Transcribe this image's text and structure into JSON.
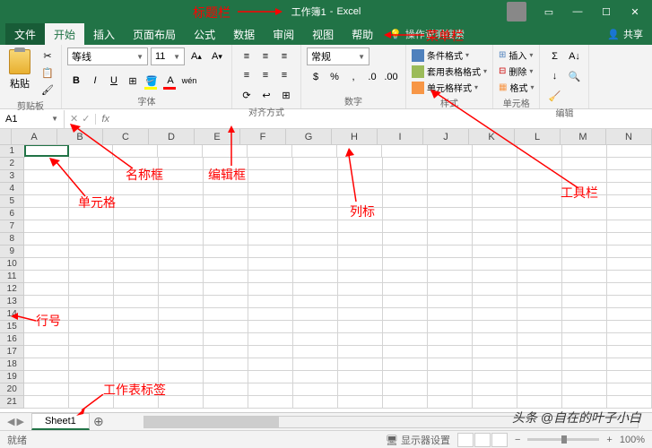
{
  "titlebar": {
    "title_doc": "工作簿1",
    "title_app": "Excel",
    "annotation": "标题栏"
  },
  "tabs": {
    "file": "文件",
    "home": "开始",
    "insert": "插入",
    "layout": "页面布局",
    "formula": "公式",
    "data": "数据",
    "review": "审阅",
    "view": "视图",
    "help": "帮助",
    "tellme": "操作说明搜索",
    "share": "共享",
    "annotation": "菜单栏"
  },
  "ribbon": {
    "clipboard": {
      "label": "剪贴板",
      "paste": "粘贴"
    },
    "font": {
      "label": "字体",
      "name": "等线",
      "size": "11"
    },
    "alignment": {
      "label": "对齐方式"
    },
    "number": {
      "label": "数字",
      "format": "常规"
    },
    "styles": {
      "label": "样式",
      "conditional": "条件格式",
      "table": "套用表格格式",
      "cell": "单元格样式"
    },
    "cells": {
      "label": "单元格",
      "insert": "插入",
      "delete": "删除",
      "format": "格式"
    },
    "editing": {
      "label": "编辑"
    },
    "annotation": "工具栏"
  },
  "formula_bar": {
    "name_box": "A1",
    "fx": "fx",
    "name_annotation": "名称框",
    "edit_annotation": "编辑框"
  },
  "grid": {
    "columns": [
      "A",
      "B",
      "C",
      "D",
      "E",
      "F",
      "G",
      "H",
      "I",
      "J",
      "K",
      "L",
      "M",
      "N"
    ],
    "rows": [
      1,
      2,
      3,
      4,
      5,
      6,
      7,
      8,
      9,
      10,
      11,
      12,
      13,
      14,
      15,
      16,
      17,
      18,
      19,
      20,
      21
    ],
    "col_annotation": "列标",
    "row_annotation": "行号",
    "cell_annotation": "单元格"
  },
  "sheets": {
    "active": "Sheet1",
    "annotation": "工作表标签"
  },
  "statusbar": {
    "ready": "就绪",
    "display": "显示器设置",
    "zoom": "100%"
  },
  "watermark": "头条 @自在的叶子小白"
}
